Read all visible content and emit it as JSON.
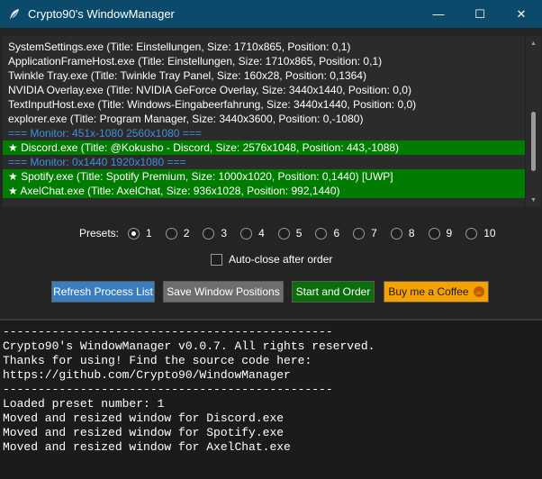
{
  "window": {
    "title": "Crypto90's WindowManager",
    "controls": {
      "minimize": "—",
      "maximize": "☐",
      "close": "✕"
    }
  },
  "process_list": {
    "rows": [
      {
        "text": "SystemSettings.exe (Title: Einstellungen, Size: 1710x865, Position: 0,1)",
        "type": "normal"
      },
      {
        "text": "ApplicationFrameHost.exe (Title: Einstellungen, Size: 1710x865, Position: 0,1)",
        "type": "normal"
      },
      {
        "text": "Twinkle Tray.exe (Title: Twinkle Tray Panel, Size: 160x28, Position: 0,1364)",
        "type": "normal"
      },
      {
        "text": "NVIDIA Overlay.exe (Title: NVIDIA GeForce Overlay, Size: 3440x1440, Position: 0,0)",
        "type": "normal"
      },
      {
        "text": "TextInputHost.exe (Title: Windows-Eingabeerfahrung, Size: 3440x1440, Position: 0,0)",
        "type": "normal"
      },
      {
        "text": "explorer.exe (Title: Program Manager, Size: 3440x3600, Position: 0,-1080)",
        "type": "normal"
      },
      {
        "text": "=== Monitor: 451x-1080 2560x1080 ===",
        "type": "monitor"
      },
      {
        "text": "★ Discord.exe (Title: @Kokusho - Discord, Size: 2576x1048, Position: 443,-1088)",
        "type": "selected"
      },
      {
        "text": "=== Monitor: 0x1440 1920x1080 ===",
        "type": "monitor"
      },
      {
        "text": "★ Spotify.exe (Title: Spotify Premium, Size: 1000x1020, Position: 0,1440) [UWP]",
        "type": "selected"
      },
      {
        "text": "★ AxelChat.exe (Title: AxelChat, Size: 936x1028, Position: 992,1440)",
        "type": "selected"
      }
    ]
  },
  "presets": {
    "label": "Presets:",
    "options": [
      "1",
      "2",
      "3",
      "4",
      "5",
      "6",
      "7",
      "8",
      "9",
      "10"
    ],
    "selected_index": 0
  },
  "autoclose": {
    "label": "Auto-close after order",
    "checked": false
  },
  "buttons": {
    "refresh": "Refresh Process List",
    "save": "Save Window Positions",
    "start": "Start and Order",
    "coffee": "Buy me a Coffee"
  },
  "console": {
    "lines": [
      "-----------------------------------------------",
      "Crypto90's WindowManager v0.0.7. All rights reserved.",
      "Thanks for using! Find the source code here:",
      "https://github.com/Crypto90/WindowManager",
      "-----------------------------------------------",
      "Loaded preset number: 1",
      "Moved and resized window for Discord.exe",
      "Moved and resized window for Spotify.exe",
      "Moved and resized window for AxelChat.exe"
    ]
  },
  "colors": {
    "titlebar": "#0b4a6a",
    "selected_row": "#007c00",
    "monitor_text": "#3f8fd6",
    "refresh_button": "#3a7ec0",
    "start_button": "#0a6f0a",
    "coffee_button": "#f5a200"
  }
}
